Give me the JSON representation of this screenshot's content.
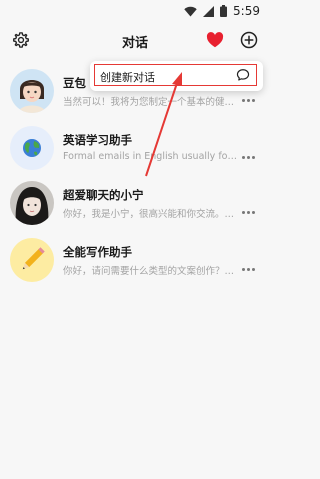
{
  "status_bar": {
    "time": "5:59"
  },
  "header": {
    "title": "对话",
    "settings_icon": "gear-icon",
    "favorite_icon": "heart-icon",
    "add_icon": "plus-circle-icon"
  },
  "popup_menu": {
    "item_label": "创建新对话",
    "item_icon": "chat-bubble-icon",
    "highlight_color": "#e53935"
  },
  "conversations": [
    {
      "name": "豆包",
      "preview": "当然可以！我将为您制定一个基本的健身计划"
    },
    {
      "name": "英语学习助手",
      "preview": "Formal emails in English usually follow a ce..."
    },
    {
      "name": "超爱聊天的小宁",
      "preview": "你好，我是小宁，很高兴能和你交流。你可..."
    },
    {
      "name": "全能写作助手",
      "preview": "你好，请问需要什么类型的文案创作？你可..."
    }
  ]
}
